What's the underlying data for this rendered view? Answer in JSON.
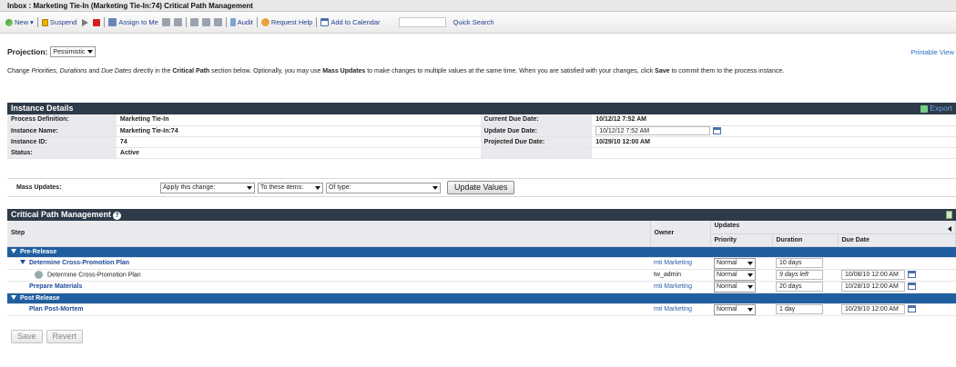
{
  "window": {
    "title": "Inbox : Marketing Tie-In (Marketing Tie-In:74) Critical Path Management"
  },
  "toolbar": {
    "new_label": "New",
    "suspend_label": "Suspend",
    "assign_label": "Assign to Me",
    "audit_label": "Audit",
    "request_help_label": "Request Help",
    "add_calendar_label": "Add to Calendar",
    "quick_search_label": "Quick Search",
    "quick_search_value": ""
  },
  "projection": {
    "label": "Projection:",
    "value": "Pessimistic"
  },
  "printable_view": "Printable View",
  "instructions": {
    "p1": "Change ",
    "p2": "Priorities, Durations",
    "p3": " and ",
    "p4": "Due Dates",
    "p5": " directly in the ",
    "p6": "Critical Path",
    "p7": " section below. Optionally, you may use ",
    "p8": "Mass Updates",
    "p9": " to make changes to multiple values at the same time. When you are satisfied with your changes, click ",
    "p10": "Save",
    "p11": " to commit them to the process instance."
  },
  "instance_details": {
    "header": "Instance Details",
    "export_label": "Export",
    "process_definition_label": "Process Definition:",
    "process_definition": "Marketing Tie-In",
    "instance_name_label": "Instance Name:",
    "instance_name": "Marketing Tie-In:74",
    "instance_id_label": "Instance ID:",
    "instance_id": "74",
    "status_label": "Status:",
    "status": "Active",
    "current_due_label": "Current Due Date:",
    "current_due": "10/12/12 7:52 AM",
    "update_due_label": "Update Due Date:",
    "update_due": "10/12/12 7:52 AM",
    "projected_due_label": "Projected Due Date:",
    "projected_due": "10/29/10 12:00 AM"
  },
  "mass_updates": {
    "label": "Mass Updates:",
    "change_select": "Apply this change:",
    "items_select": "To these items:",
    "type_select": "Of type:",
    "update_button": "Update Values"
  },
  "cpm": {
    "header": "Critical Path Management",
    "col_step": "Step",
    "col_owner": "Owner",
    "col_updates": "Updates",
    "col_priority": "Priority",
    "col_duration": "Duration",
    "col_due": "Due Date",
    "groups": [
      {
        "name": "Pre-Release",
        "rows": [
          {
            "step": "Determine Cross-Promotion Plan",
            "owner": "mti Marketing",
            "priority": "Normal",
            "duration": "10 days",
            "due": ""
          },
          {
            "step": "Determine Cross-Promotion Plan",
            "owner": "tw_admin",
            "priority": "Normal",
            "duration": "9 days left",
            "due": "10/08/10 12:00 AM"
          },
          {
            "step": "Prepare Materials",
            "owner": "mti Marketing",
            "priority": "Normal",
            "duration": "20 days",
            "due": "10/28/10 12:00 AM"
          }
        ]
      },
      {
        "name": "Post Release",
        "rows": [
          {
            "step": "Plan Post-Mortem",
            "owner": "mti Marketing",
            "priority": "Normal",
            "duration": "1 day",
            "due": "10/29/10 12:00 AM"
          }
        ]
      }
    ]
  },
  "footer": {
    "save_label": "Save",
    "revert_label": "Revert"
  }
}
